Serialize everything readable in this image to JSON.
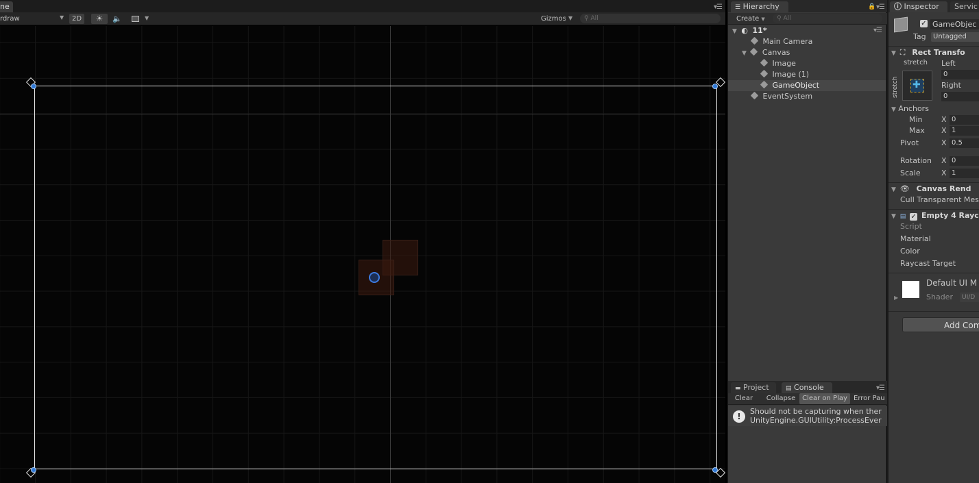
{
  "scene": {
    "tab_label": "ne",
    "draw_mode": "rdraw",
    "btn_2d": "2D",
    "gizmos_label": "Gizmos",
    "search_placeholder": "All"
  },
  "hierarchy": {
    "tab_label": "Hierarchy",
    "create_label": "Create",
    "search_placeholder": "All",
    "scene_name": "11*",
    "items": [
      {
        "label": "Main Camera"
      },
      {
        "label": "Canvas"
      },
      {
        "label": "Image"
      },
      {
        "label": "Image (1)"
      },
      {
        "label": "GameObject"
      },
      {
        "label": "EventSystem"
      }
    ]
  },
  "console": {
    "tab_project": "Project",
    "tab_console": "Console",
    "buttons": {
      "clear": "Clear",
      "collapse": "Collapse",
      "clear_on_play": "Clear on Play",
      "error_pause": "Error Pau"
    },
    "message_line1": "Should not be capturing when ther",
    "message_line2": "UnityEngine.GUIUtility:ProcessEver"
  },
  "inspector": {
    "tab_inspector": "Inspector",
    "tab_services": "Servic",
    "object_name": "GameObjec",
    "tag_label": "Tag",
    "tag_value": "Untagged",
    "rect_transform": "Rect Transfo",
    "stretch_top": "stretch",
    "stretch_side": "stretch",
    "left_label": "Left",
    "left_value": "0",
    "right_label": "Right",
    "right_value": "0",
    "anchors_label": "Anchors",
    "min_label": "Min",
    "min_x_label": "X",
    "min_x": "0",
    "max_label": "Max",
    "max_x_label": "X",
    "max_x": "1",
    "pivot_label": "Pivot",
    "pivot_x_label": "X",
    "pivot_x": "0.5",
    "rotation_label": "Rotation",
    "rotation_x_label": "X",
    "rotation_x": "0",
    "scale_label": "Scale",
    "scale_x_label": "X",
    "scale_x": "1",
    "canvas_renderer": "Canvas Rend",
    "cull_label": "Cull Transparent Mes",
    "empty_raycast": "Empty 4 Rayc",
    "script_label": "Script",
    "material_label": "Material",
    "color_label": "Color",
    "raycast_label": "Raycast Target",
    "material_name": "Default UI M",
    "shader_label": "Shader",
    "shader_value": "UI/D",
    "add_component": "Add Com"
  }
}
